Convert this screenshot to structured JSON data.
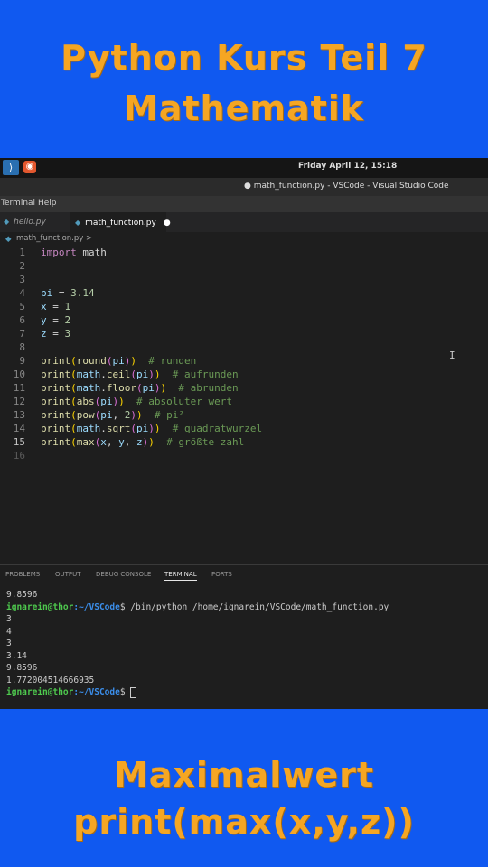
{
  "banner_top": {
    "line1": "Python Kurs Teil 7",
    "line2": "Mathematik"
  },
  "banner_bottom": {
    "line1": "Maximalwert",
    "line2": "print(max(x,y,z))"
  },
  "system_bar": {
    "clock": "Friday April 12, 15:18"
  },
  "window": {
    "title": "● math_function.py - VSCode - Visual Studio Code"
  },
  "menu": {
    "items": [
      "Terminal",
      "Help"
    ]
  },
  "tabs": [
    {
      "label": "hello.py",
      "active": false
    },
    {
      "label": "math_function.py",
      "active": true,
      "modified": "●"
    }
  ],
  "breadcrumb": "math_function.py >",
  "editor": {
    "current_line": 15,
    "lines": [
      "1",
      "2",
      "3",
      "4",
      "5",
      "6",
      "7",
      "8",
      "9",
      "10",
      "11",
      "12",
      "13",
      "14",
      "15",
      "16"
    ],
    "code": {
      "l1": [
        "import",
        "math"
      ],
      "l4": [
        "pi",
        "=",
        "3.14"
      ],
      "l5": [
        "x",
        "=",
        "1"
      ],
      "l6": [
        "y",
        "=",
        "2"
      ],
      "l7": [
        "z",
        "=",
        "3"
      ],
      "c9": "# runden",
      "c10": "# aufrunden",
      "c11": "# abrunden",
      "c12": "# absoluter wert",
      "c13": "# pi²",
      "c14": "# quadratwurzel",
      "c15": "# größte zahl"
    }
  },
  "panel": {
    "tabs": [
      "PROBLEMS",
      "OUTPUT",
      "DEBUG CONSOLE",
      "TERMINAL",
      "PORTS"
    ],
    "active_tab": "TERMINAL"
  },
  "terminal": {
    "prev_output": "9.8596",
    "prompt_user": "ignarein@thor",
    "prompt_path": ":~/VSCode",
    "prompt_end": "$",
    "command": " /bin/python /home/ignarein/VSCode/math_function.py",
    "output": [
      "3",
      "4",
      "3",
      "3.14",
      "9.8596",
      "1.772004514666935"
    ]
  },
  "colors": {
    "background": "#1059f0",
    "banner_text": "#f5a623",
    "editor_bg": "#1e1e1e"
  },
  "icons": [
    "vscode-icon",
    "ubuntu-icon",
    "python-file-icon",
    "text-cursor-icon"
  ]
}
